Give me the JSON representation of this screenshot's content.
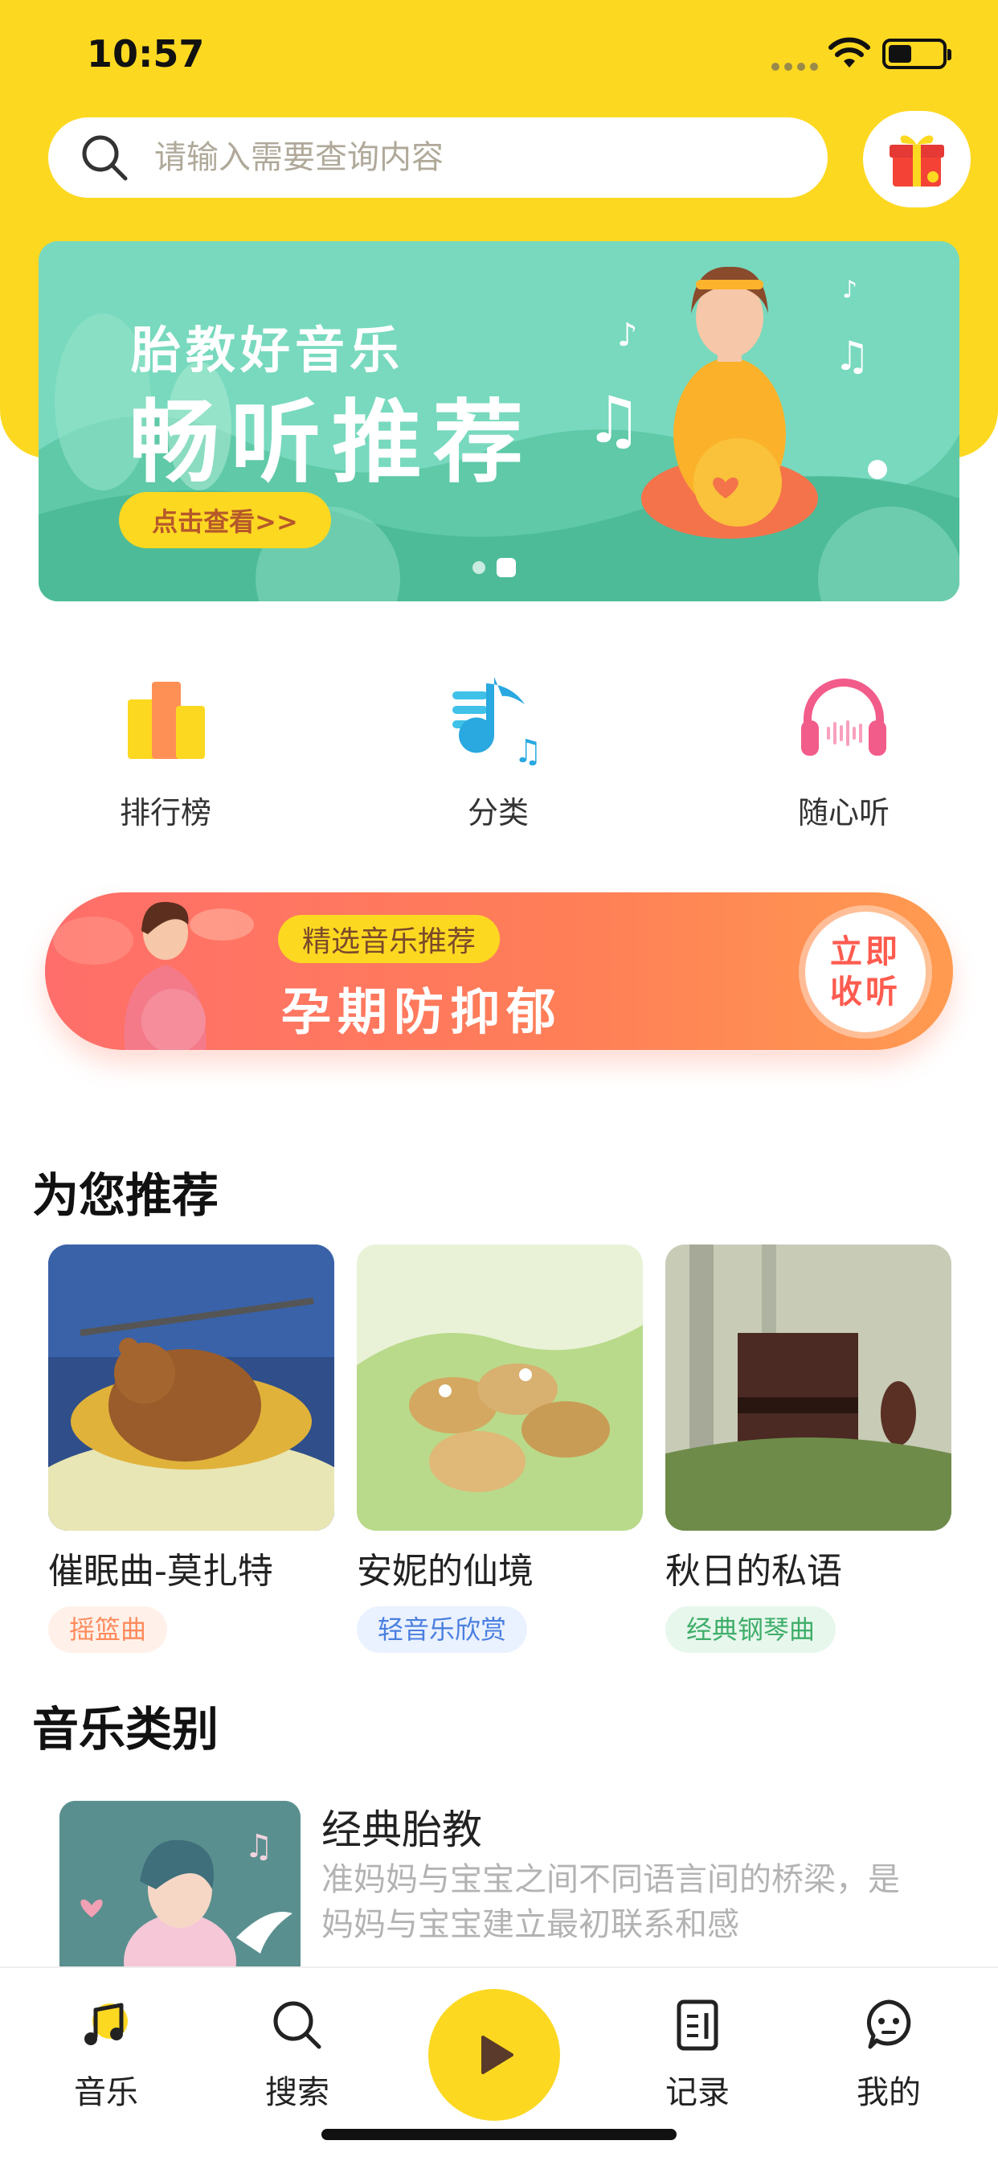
{
  "status_bar": {
    "time": "10:57"
  },
  "search": {
    "placeholder": "请输入需要查询内容",
    "icon": "search-icon"
  },
  "gift": {
    "icon": "gift-icon"
  },
  "banner": {
    "subtitle": "胎教好音乐",
    "title": "畅听推荐",
    "button": "点击查看>>",
    "page_count": 2,
    "active_page": 2
  },
  "quick_nav": [
    {
      "label": "排行榜",
      "icon": "ranking-icon"
    },
    {
      "label": "分类",
      "icon": "category-icon"
    },
    {
      "label": "随心听",
      "icon": "headphones-icon"
    }
  ],
  "promo": {
    "tag": "精选音乐推荐",
    "title": "孕期防抑郁",
    "button_line1": "立即",
    "button_line2": "收听"
  },
  "recommend": {
    "heading": "为您推荐",
    "items": [
      {
        "title": "催眠曲-莫扎特",
        "tag": "摇篮曲",
        "tag_color": "#FF8A5B",
        "tag_bg": "#FFF1EA"
      },
      {
        "title": "安妮的仙境",
        "tag": "轻音乐欣赏",
        "tag_color": "#4A7FE0",
        "tag_bg": "#EAF1FF"
      },
      {
        "title": "秋日的私语",
        "tag": "经典钢琴曲",
        "tag_color": "#3FAE6A",
        "tag_bg": "#E7F7EC"
      }
    ]
  },
  "categories": {
    "heading": "音乐类别",
    "items": [
      {
        "title": "经典胎教",
        "description": "准妈妈与宝宝之间不同语言间的桥梁，是妈妈与宝宝建立最初联系和感"
      }
    ]
  },
  "tabbar": {
    "tabs": [
      {
        "label": "音乐",
        "icon": "music-note-icon"
      },
      {
        "label": "搜索",
        "icon": "search-icon"
      },
      {
        "label": "记录",
        "icon": "record-icon"
      },
      {
        "label": "我的",
        "icon": "profile-icon"
      }
    ],
    "play": "play-icon"
  },
  "colors": {
    "accent": "#FDD821",
    "banner": "#78D9BE",
    "promo": "#FF6E6A"
  }
}
